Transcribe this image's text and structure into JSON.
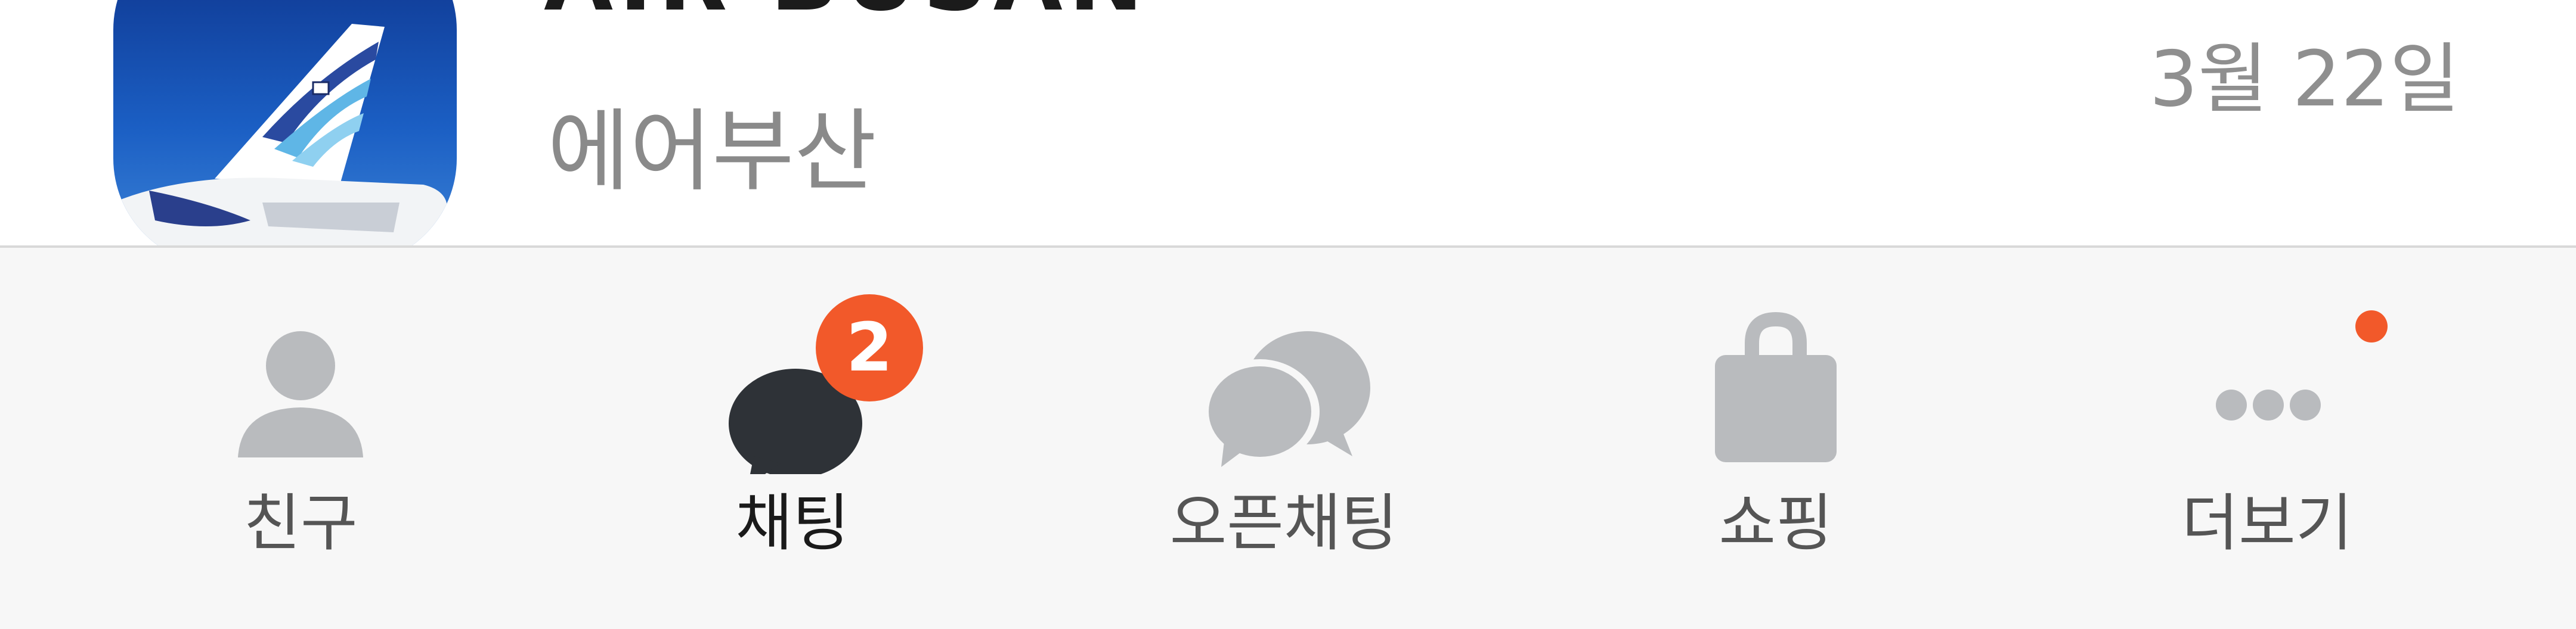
{
  "chat_row": {
    "title": "AIR BUSAN",
    "subtitle": "에어부산",
    "date": "3월 22일"
  },
  "tabs": [
    {
      "label": "친구",
      "icon": "friends-icon",
      "active": false
    },
    {
      "label": "채팅",
      "icon": "chat-icon",
      "active": true,
      "badge": "2"
    },
    {
      "label": "오픈채팅",
      "icon": "open-chat-icon",
      "active": false
    },
    {
      "label": "쇼핑",
      "icon": "shopping-bag-icon",
      "active": false
    },
    {
      "label": "더보기",
      "icon": "more-icon",
      "active": false,
      "dot": true
    }
  ],
  "colors": {
    "badge": "#f2592a",
    "icon_inactive": "#b9bbbe",
    "icon_active": "#2e3237",
    "avatar_bg": "#1b4ea8"
  }
}
